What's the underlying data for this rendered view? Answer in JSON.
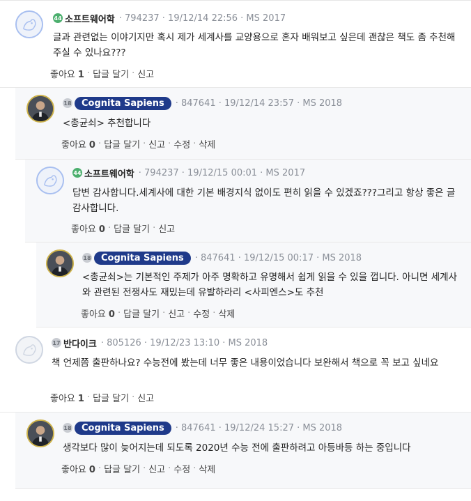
{
  "comments": [
    {
      "level": "44",
      "author": "소프트웨어학",
      "meta": "· 794237 · 19/12/14 22:56 · MS 2017",
      "body": "글과 관련없는 이야기지만 혹시 제가 세계사를 교양용으로 혼자 배워보고 싶은데 괜찮은 책도 좀 추천해주실 수 있나요???",
      "like_label": "좋아요",
      "like_count": "1",
      "reply_label": "답글 달기",
      "report_label": "신고"
    },
    {
      "level": "18",
      "author": "Cognita Sapiens",
      "meta": "· 847641 · 19/12/14 23:57 · MS 2018",
      "body": "<총균쇠> 추천합니다",
      "like_label": "좋아요",
      "like_count": "0",
      "reply_label": "답글 달기",
      "report_label": "신고",
      "edit_label": "수정",
      "delete_label": "삭제"
    },
    {
      "level": "44",
      "author": "소프트웨어학",
      "meta": "· 794237 · 19/12/15 00:01 · MS 2017",
      "body": "답변 감사합니다.세계사에 대한 기본 배경지식 없이도 편히 읽을 수 있겠죠???그리고 항상 좋은 글 감사합니다.",
      "like_label": "좋아요",
      "like_count": "0",
      "reply_label": "답글 달기",
      "report_label": "신고"
    },
    {
      "level": "18",
      "author": "Cognita Sapiens",
      "meta": "· 847641 · 19/12/15 00:17 · MS 2018",
      "body": "<총균쇠>는 기본적인 주제가 아주 명확하고 유명해서 쉽게 읽을 수 있을 껍니다. 아니면 세계사와 관련된 전쟁사도 재밌는데 유발하라리 <사피엔스>도 추천",
      "like_label": "좋아요",
      "like_count": "0",
      "reply_label": "답글 달기",
      "report_label": "신고",
      "edit_label": "수정",
      "delete_label": "삭제"
    },
    {
      "level": "17",
      "author": "반다이크",
      "meta": "· 805126 · 19/12/23 13:10 · MS 2018",
      "body": "책 언제쯤 출판하나요? 수능전에 봤는데 너무 좋은 내용이었습니다 보완해서 책으로 꼭 보고 싶네요",
      "like_label": "좋아요",
      "like_count": "1",
      "reply_label": "답글 달기",
      "report_label": "신고"
    },
    {
      "level": "18",
      "author": "Cognita Sapiens",
      "meta": "· 847641 · 19/12/24 15:27 · MS 2018",
      "body": "생각보다 많이 늦어지는데 되도록 2020년 수능 전에 출판하려고 아등바등 하는 중입니다",
      "like_label": "좋아요",
      "like_count": "0",
      "reply_label": "답글 달기",
      "report_label": "신고",
      "edit_label": "수정",
      "delete_label": "삭제"
    }
  ]
}
